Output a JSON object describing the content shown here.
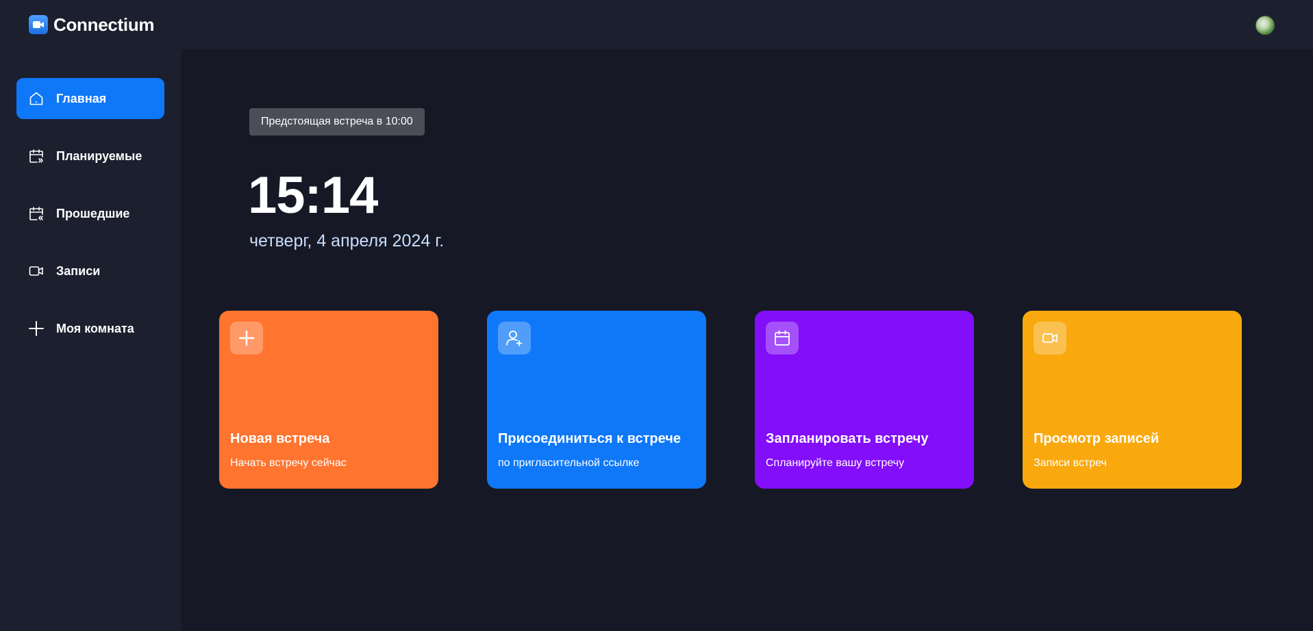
{
  "app": {
    "title": "Connectium"
  },
  "colors": {
    "background": "#161925",
    "panel": "#1c1f2e",
    "accent_blue": "#0e78f9",
    "orange": "#ff742e",
    "purple": "#830ef9",
    "yellow": "#f9a90e",
    "badge": "#4b4e57"
  },
  "sidebar": {
    "items": [
      {
        "label": "Главная",
        "icon": "home-icon",
        "active": true
      },
      {
        "label": "Планируемые",
        "icon": "calendar-upcoming-icon",
        "active": false
      },
      {
        "label": "Прошедшие",
        "icon": "calendar-previous-icon",
        "active": false
      },
      {
        "label": "Записи",
        "icon": "video-icon",
        "active": false
      },
      {
        "label": "Моя комната",
        "icon": "plus-icon",
        "active": false
      }
    ]
  },
  "main": {
    "upcoming_label": "Предстоящая встреча в 10:00",
    "time": "15:14",
    "date": "четверг, 4 апреля 2024 г.",
    "cards": [
      {
        "title": "Новая встреча",
        "subtitle": "Начать встречу сейчас",
        "icon": "plus-icon",
        "color": "#ff742e"
      },
      {
        "title": "Присоединиться к встрече",
        "subtitle": "по пригласительной ссылке",
        "icon": "add-user-icon",
        "color": "#0e78f9"
      },
      {
        "title": "Запланировать встречу",
        "subtitle": "Спланируйте вашу встречу",
        "icon": "calendar-icon",
        "color": "#830ef9"
      },
      {
        "title": "Просмотр записей",
        "subtitle": "Записи встреч",
        "icon": "video-icon",
        "color": "#f9a90e"
      }
    ]
  }
}
